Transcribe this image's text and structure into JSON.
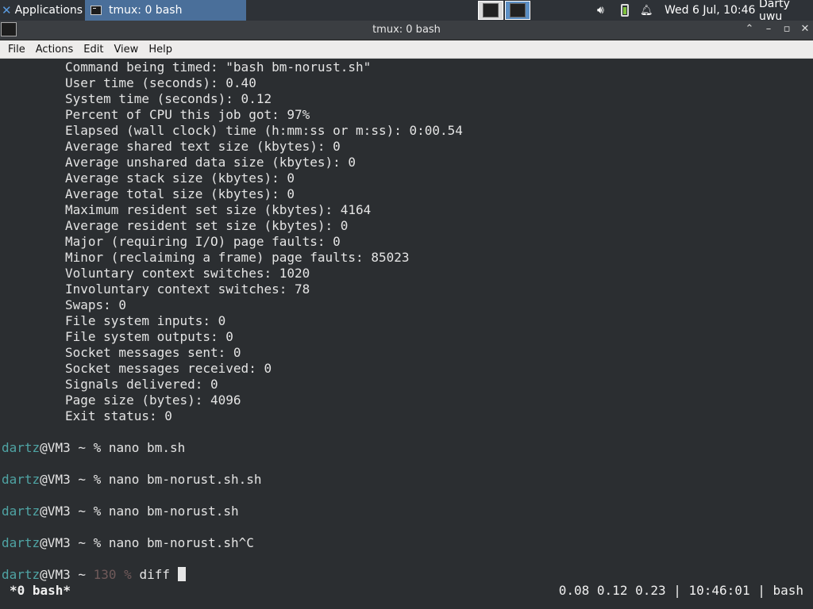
{
  "panel": {
    "applications_label": "Applications",
    "task_label": "tmux: 0 bash",
    "clock": "Wed  6 Jul, 10:46",
    "user": "Darty uwu"
  },
  "window": {
    "title": "tmux: 0 bash",
    "menu": [
      "File",
      "Actions",
      "Edit",
      "View",
      "Help"
    ]
  },
  "terminal": {
    "time_output": [
      "Command being timed: \"bash bm-norust.sh\"",
      "User time (seconds): 0.40",
      "System time (seconds): 0.12",
      "Percent of CPU this job got: 97%",
      "Elapsed (wall clock) time (h:mm:ss or m:ss): 0:00.54",
      "Average shared text size (kbytes): 0",
      "Average unshared data size (kbytes): 0",
      "Average stack size (kbytes): 0",
      "Average total size (kbytes): 0",
      "Maximum resident set size (kbytes): 4164",
      "Average resident set size (kbytes): 0",
      "Major (requiring I/O) page faults: 0",
      "Minor (reclaiming a frame) page faults: 85023",
      "Voluntary context switches: 1020",
      "Involuntary context switches: 78",
      "Swaps: 0",
      "File system inputs: 0",
      "File system outputs: 0",
      "Socket messages sent: 0",
      "Socket messages received: 0",
      "Signals delivered: 0",
      "Page size (bytes): 4096",
      "Exit status: 0"
    ],
    "prompt_user": "dartz",
    "prompt_host": "@VM3 ~ ",
    "prompt_symbol": "%",
    "commands": [
      "nano bm.sh",
      "nano bm-norust.sh.sh",
      "nano bm-norust.sh",
      "nano bm-norust.sh^C"
    ],
    "last_exit_code": "130",
    "current_input": "diff "
  },
  "statusbar": {
    "window_label": "*0 bash*",
    "right": "0.08 0.12 0.23 | 10:46:01 | bash"
  }
}
